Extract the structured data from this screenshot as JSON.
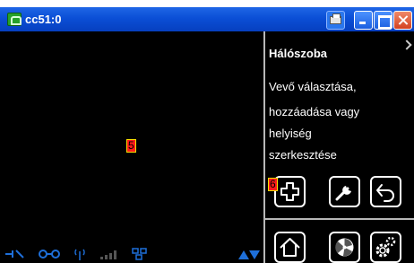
{
  "window": {
    "title": "cc51:0",
    "titlebar_colors": {
      "base": "#0b4fd6",
      "close": "#d4411f"
    }
  },
  "viewport": {
    "marker": "5"
  },
  "panel": {
    "title": "Hálószoba",
    "description": [
      "Vevő választása,",
      "hozzáadása vagy",
      "helyiség",
      "szerkesztése"
    ],
    "marker": "6"
  },
  "buttons": [
    {
      "name": "add-button",
      "icon": "plus-icon"
    },
    {
      "name": "edit-button",
      "icon": "wrench-icon"
    },
    {
      "name": "back-button",
      "icon": "back-arrow-icon"
    },
    {
      "name": "home-button",
      "icon": "home-icon"
    },
    {
      "name": "fan-button",
      "icon": "fan-icon"
    },
    {
      "name": "settings-button",
      "icon": "gears-icon"
    }
  ],
  "status_icons": [
    "connection-icon",
    "link-icon",
    "antenna-icon",
    "signal-bars-icon",
    "network-icon"
  ],
  "accent_color": "#1e6fd9"
}
